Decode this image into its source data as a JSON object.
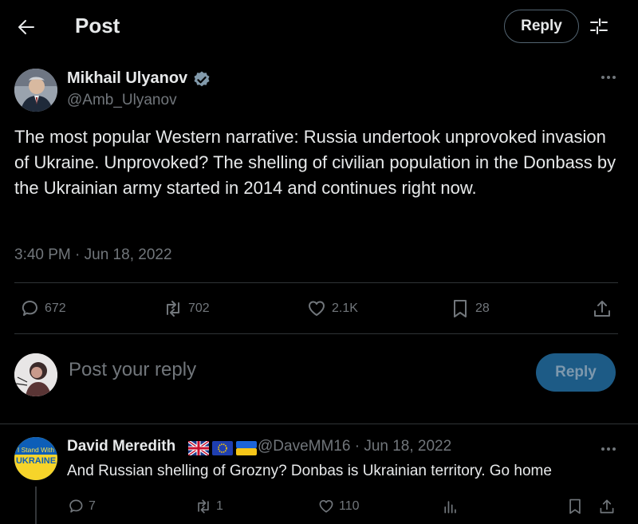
{
  "header": {
    "title": "Post",
    "reply_label": "Reply"
  },
  "post": {
    "author_name": "Mikhail Ulyanov",
    "author_handle": "@Amb_Ulyanov",
    "text": "The most popular Western narrative: Russia undertook unprovoked invasion of Ukraine. Unprovoked? The  shelling of civilian population in the Donbass by the Ukrainian army started in 2014 and continues right now.",
    "timestamp": "3:40 PM · Jun 18, 2022",
    "stats": {
      "replies": "672",
      "reposts": "702",
      "likes": "2.1K",
      "bookmarks": "28"
    }
  },
  "compose": {
    "placeholder": "Post your reply",
    "reply_label": "Reply"
  },
  "reply": {
    "author_name": "David Meredith",
    "handle_time": "@DaveMM16 · Jun 18, 2022",
    "avatar_text_top": "I Stand With",
    "avatar_text_bottom": "UKRAINE",
    "text": "And Russian shelling of Grozny? Donbas is Ukrainian territory. Go home",
    "stats": {
      "replies": "7",
      "reposts": "1",
      "likes": "110"
    }
  },
  "colors": {
    "background": "#000000",
    "text": "#e7e9ea",
    "muted": "#71767b",
    "divider": "#2f3336",
    "verified": "#829aab",
    "reply_button_disabled": "#1d5b86"
  }
}
